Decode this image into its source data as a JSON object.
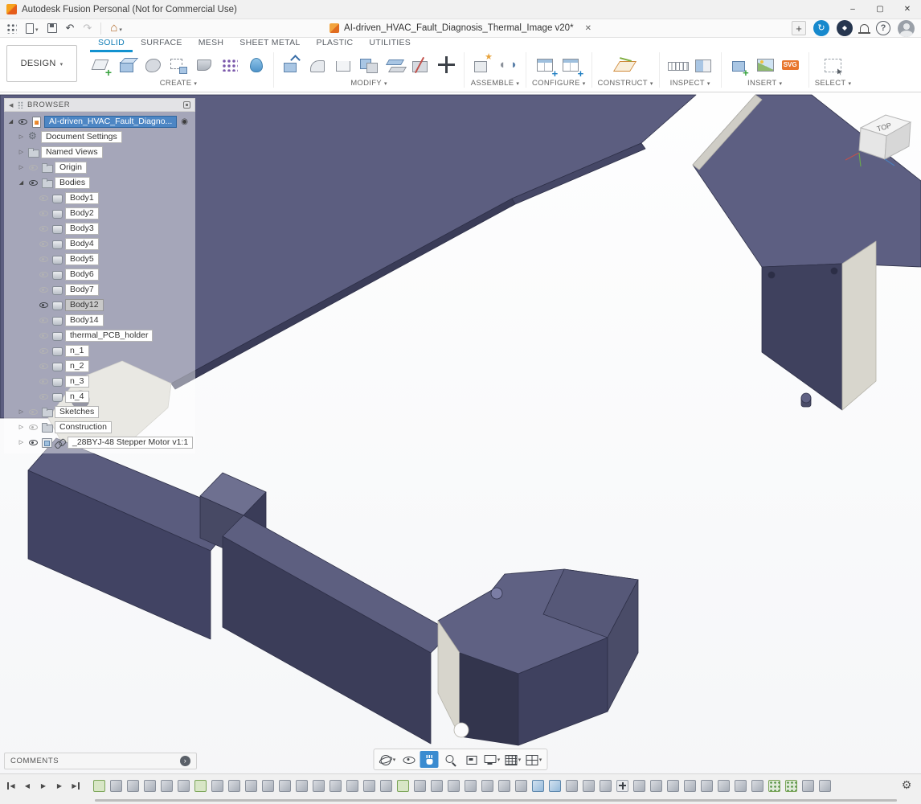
{
  "titlebar": {
    "title": "Autodesk Fusion Personal (Not for Commercial Use)",
    "minimize": "–",
    "maximize": "▢",
    "close": "✕"
  },
  "header": {
    "doc_title": "AI-driven_HVAC_Fault_Diagnosis_Thermal_Image v20*",
    "close_tab": "✕",
    "new_tab": "+",
    "help": "?"
  },
  "ribbon": {
    "design_menu": "DESIGN",
    "tabs": [
      {
        "label": "SOLID",
        "active": true
      },
      {
        "label": "SURFACE"
      },
      {
        "label": "MESH"
      },
      {
        "label": "SHEET METAL"
      },
      {
        "label": "PLASTIC"
      },
      {
        "label": "UTILITIES"
      }
    ],
    "groups": [
      {
        "label": "CREATE",
        "icons": [
          "create-sketch",
          "box",
          "form",
          "derive",
          "emboss",
          "pattern",
          "pipe"
        ]
      },
      {
        "label": "MODIFY",
        "icons": [
          "press-pull",
          "fillet",
          "shell",
          "combine",
          "offset-face",
          "split-body",
          "move-copy"
        ]
      },
      {
        "label": "ASSEMBLE",
        "icons": [
          "new-component",
          "joint"
        ]
      },
      {
        "label": "CONFIGURE",
        "icons": [
          "configuration",
          "configuration-table"
        ]
      },
      {
        "label": "CONSTRUCT",
        "icons": [
          "construction-plane"
        ]
      },
      {
        "label": "INSPECT",
        "icons": [
          "measure",
          "section-analysis"
        ]
      },
      {
        "label": "INSERT",
        "icons": [
          "insert-derive",
          "decal",
          "insert-svg"
        ]
      },
      {
        "label": "SELECT",
        "icons": [
          "select-window"
        ]
      }
    ]
  },
  "browser": {
    "header": "BROWSER",
    "rows": [
      {
        "label": "AI-driven_HVAC_Fault_Diagno...",
        "indent": 0,
        "arrow": "expanded",
        "has_eye": true,
        "icon": "document",
        "selected": true,
        "radio": true
      },
      {
        "label": "Document Settings",
        "indent": 1,
        "arrow": "collapsed",
        "icon": "gear"
      },
      {
        "label": "Named Views",
        "indent": 1,
        "arrow": "collapsed",
        "icon": "folder"
      },
      {
        "label": "Origin",
        "indent": 1,
        "arrow": "collapsed",
        "has_eye": true,
        "eye_dim": true,
        "icon": "folder"
      },
      {
        "label": "Bodies",
        "indent": 1,
        "arrow": "expanded",
        "has_eye": true,
        "icon": "folder"
      },
      {
        "label": "Body1",
        "indent": 2,
        "has_eye": true,
        "eye_dim": true,
        "icon": "body"
      },
      {
        "label": "Body2",
        "indent": 2,
        "has_eye": true,
        "eye_dim": true,
        "icon": "body"
      },
      {
        "label": "Body3",
        "indent": 2,
        "has_eye": true,
        "eye_dim": true,
        "icon": "body"
      },
      {
        "label": "Body4",
        "indent": 2,
        "has_eye": true,
        "eye_dim": true,
        "icon": "body"
      },
      {
        "label": "Body5",
        "indent": 2,
        "has_eye": true,
        "eye_dim": true,
        "icon": "body"
      },
      {
        "label": "Body6",
        "indent": 2,
        "has_eye": true,
        "eye_dim": true,
        "icon": "body"
      },
      {
        "label": "Body7",
        "indent": 2,
        "has_eye": true,
        "eye_dim": true,
        "icon": "body"
      },
      {
        "label": "Body12",
        "indent": 2,
        "has_eye": true,
        "icon": "body",
        "highlight": true
      },
      {
        "label": "Body14",
        "indent": 2,
        "has_eye": true,
        "eye_dim": true,
        "icon": "body"
      },
      {
        "label": "thermal_PCB_holder",
        "indent": 2,
        "has_eye": true,
        "eye_dim": true,
        "icon": "body"
      },
      {
        "label": "n_1",
        "indent": 2,
        "has_eye": true,
        "eye_dim": true,
        "icon": "body"
      },
      {
        "label": "n_2",
        "indent": 2,
        "has_eye": true,
        "eye_dim": true,
        "icon": "body"
      },
      {
        "label": "n_3",
        "indent": 2,
        "has_eye": true,
        "eye_dim": true,
        "icon": "body"
      },
      {
        "label": "n_4",
        "indent": 2,
        "has_eye": true,
        "eye_dim": true,
        "icon": "body"
      },
      {
        "label": "Sketches",
        "indent": 1,
        "arrow": "collapsed",
        "has_eye": true,
        "eye_dim": true,
        "icon": "folder"
      },
      {
        "label": "Construction",
        "indent": 1,
        "arrow": "collapsed",
        "has_eye": true,
        "eye_dim": true,
        "icon": "folder"
      },
      {
        "label": "_28BYJ-48 Stepper Motor v1:1",
        "indent": 1,
        "arrow": "collapsed",
        "has_eye": true,
        "icon": "component",
        "link": true
      }
    ]
  },
  "viewcube": {
    "top": "TOP"
  },
  "navbar": {
    "items": [
      {
        "name": "orbit",
        "caret": true
      },
      {
        "name": "look-at"
      },
      {
        "name": "pan",
        "active": true
      },
      {
        "name": "zoom"
      },
      {
        "name": "fit"
      },
      {
        "name": "display-settings",
        "caret": true
      },
      {
        "name": "grid-settings",
        "caret": true
      },
      {
        "name": "viewports",
        "caret": true
      }
    ]
  },
  "comments": {
    "label": "COMMENTS",
    "toggle_glyph": "›"
  },
  "timeline": {
    "playback": [
      {
        "name": "go-to-start",
        "glyph": "◀",
        "cls": "barL"
      },
      {
        "name": "step-back",
        "glyph": "◀"
      },
      {
        "name": "play",
        "glyph": "▶"
      },
      {
        "name": "step-forward",
        "glyph": "▶"
      },
      {
        "name": "go-to-end",
        "glyph": "▶",
        "cls": "barR"
      }
    ],
    "features": [
      "sketch",
      "extrude",
      "extrude",
      "extrude",
      "extrude",
      "extrude",
      "sketch",
      "extrude",
      "extrude",
      "extrude",
      "extrude",
      "extrude",
      "extrude",
      "extrude",
      "extrude",
      "extrude",
      "extrude",
      "extrude",
      "sketch",
      "extrude",
      "extrude",
      "extrude",
      "extrude",
      "extrude",
      "extrude",
      "extrude",
      "combine",
      "combine",
      "extrude",
      "extrude",
      "extrude",
      "move",
      "extrude",
      "extrude",
      "extrude",
      "extrude",
      "extrude",
      "extrude",
      "extrude",
      "extrude",
      "pattern",
      "pattern",
      "extrude",
      "extrude"
    ]
  }
}
